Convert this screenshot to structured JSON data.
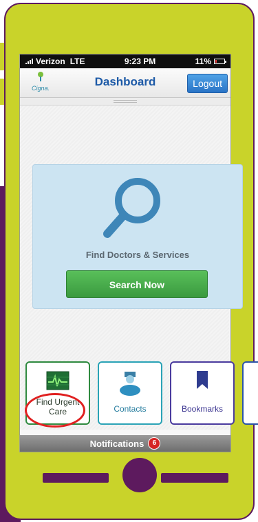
{
  "status_bar": {
    "carrier": "Verizon",
    "network": "LTE",
    "time": "9:23 PM",
    "battery": "11%"
  },
  "nav": {
    "logo_text": "Cigna.",
    "title": "Dashboard",
    "logout_label": "Logout"
  },
  "search_card": {
    "title": "Find Doctors & Services",
    "button_label": "Search Now"
  },
  "tiles": [
    {
      "label": "Find Urgent Care",
      "icon": "ecg-monitor-icon"
    },
    {
      "label": "Contacts",
      "icon": "doctor-icon"
    },
    {
      "label": "Bookmarks",
      "icon": "bookmark-icon"
    }
  ],
  "notifications": {
    "label": "Notifications",
    "count": "6"
  },
  "colors": {
    "lime": "#c9d32a",
    "purple": "#5d1a5e",
    "nav_title": "#1d5aa7",
    "search_button": "#3a9a3f",
    "highlight_circle": "#e02020"
  }
}
